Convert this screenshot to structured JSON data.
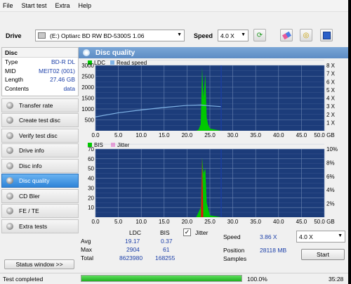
{
  "menu": [
    "File",
    "Start test",
    "Extra",
    "Help"
  ],
  "toolbar": {
    "drive_label": "Drive",
    "drive_value": "(E:)  Optiarc BD RW BD-5300S 1.06",
    "speed_label": "Speed",
    "speed_value": "4.0 X"
  },
  "disc": {
    "header": "Disc",
    "rows": [
      {
        "k": "Type",
        "v": "BD-R DL"
      },
      {
        "k": "MID",
        "v": "MEIT02 (001)"
      },
      {
        "k": "Length",
        "v": "27.46 GB"
      },
      {
        "k": "Contents",
        "v": "data"
      }
    ]
  },
  "nav": [
    {
      "label": "Transfer rate",
      "active": false
    },
    {
      "label": "Create test disc",
      "active": false
    },
    {
      "label": "Verify test disc",
      "active": false
    },
    {
      "label": "Drive info",
      "active": false
    },
    {
      "label": "Disc info",
      "active": false
    },
    {
      "label": "Disc quality",
      "active": true
    },
    {
      "label": "CD Bler",
      "active": false
    },
    {
      "label": "FE / TE",
      "active": false
    },
    {
      "label": "Extra tests",
      "active": false
    }
  ],
  "status_window_label": "Status window >>",
  "panel_title": "Disc quality",
  "colors": {
    "ldc": "#00c800",
    "read_speed": "#7fb3e6",
    "bis": "#00c800",
    "jitter": "#e8a0d8",
    "plot_bg": "#1c3c7a",
    "grid": "#6e87b4",
    "marker": "#1a3ea8"
  },
  "chart_data": [
    {
      "type": "area",
      "legend": [
        "LDC",
        "Read speed"
      ],
      "x": [
        0,
        5,
        10,
        15,
        20,
        22,
        22.5,
        23,
        23.3,
        23.6,
        24,
        24.3,
        24.6,
        25,
        27.46
      ],
      "ldc_values": [
        0,
        0,
        0,
        0,
        0,
        0,
        50,
        300,
        2904,
        1500,
        2600,
        600,
        300,
        100,
        0
      ],
      "read_speed_x": [
        0,
        5,
        10,
        15,
        20,
        23,
        25,
        27.46
      ],
      "read_speed_values": [
        1.7,
        2.2,
        2.55,
        2.85,
        3.1,
        3.15,
        3.05,
        2.95
      ],
      "xlim": [
        0,
        50
      ],
      "x_ticks": [
        "0.0",
        "5.0",
        "10.0",
        "15.0",
        "20.0",
        "25.0",
        "30.0",
        "35.0",
        "40.0",
        "45.0",
        "50.0 GB"
      ],
      "y_ticks_left": [
        "500",
        "1000",
        "1500",
        "2000",
        "2500",
        "3000"
      ],
      "ylim_left": [
        0,
        3000
      ],
      "y_ticks_right": [
        "1 X",
        "2 X",
        "3 X",
        "4 X",
        "5 X",
        "6 X",
        "7 X",
        "8 X"
      ],
      "ylim_right": [
        0,
        8
      ],
      "end_marker_x": 27.46
    },
    {
      "type": "area",
      "legend": [
        "BIS",
        "Jitter"
      ],
      "x": [
        0,
        22,
        23,
        23.3,
        23.6,
        24,
        24.3,
        25,
        27.46
      ],
      "bis_values": [
        0,
        0,
        10,
        61,
        45,
        50,
        15,
        2,
        0
      ],
      "xlim": [
        0,
        50
      ],
      "x_ticks": [
        "0.0",
        "5.0",
        "10.0",
        "15.0",
        "20.0",
        "25.0",
        "30.0",
        "35.0",
        "40.0",
        "45.0",
        "50.0 GB"
      ],
      "y_ticks_left": [
        "10",
        "20",
        "30",
        "40",
        "50",
        "60",
        "70"
      ],
      "ylim_left": [
        0,
        70
      ],
      "y_ticks_right": [
        "2%",
        "4%",
        "6%",
        "8%",
        "10%"
      ],
      "ylim_right": [
        0,
        10
      ],
      "end_marker_x": 27.46
    }
  ],
  "stats": {
    "col_ldc": "LDC",
    "col_bis": "BIS",
    "jitter_label": "Jitter",
    "rows": [
      {
        "label": "Avg",
        "ldc": "19.17",
        "bis": "0.37"
      },
      {
        "label": "Max",
        "ldc": "2904",
        "bis": "61"
      },
      {
        "label": "Total",
        "ldc": "8623980",
        "bis": "168255"
      }
    ],
    "speed_label": "Speed",
    "speed_value": "3.86 X",
    "speed_select": "4.0 X",
    "position_label": "Position",
    "position_value": "28118 MB",
    "samples_label": "Samples",
    "start_label": "Start"
  },
  "statusbar": {
    "text": "Test completed",
    "progress": 100,
    "percent": "100.0%",
    "time": "35:28"
  }
}
